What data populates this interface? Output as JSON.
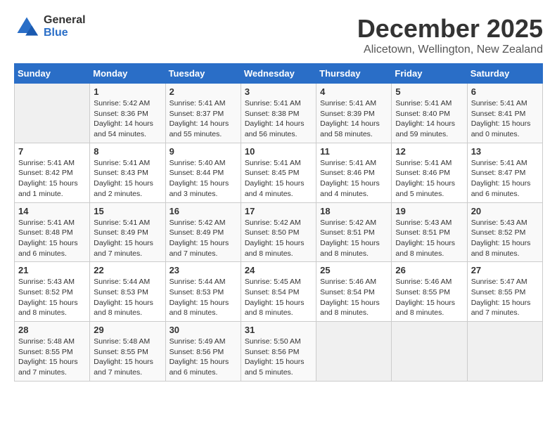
{
  "logo": {
    "general": "General",
    "blue": "Blue"
  },
  "title": "December 2025",
  "subtitle": "Alicetown, Wellington, New Zealand",
  "days_of_week": [
    "Sunday",
    "Monday",
    "Tuesday",
    "Wednesday",
    "Thursday",
    "Friday",
    "Saturday"
  ],
  "weeks": [
    [
      {
        "day": "",
        "info": ""
      },
      {
        "day": "1",
        "info": "Sunrise: 5:42 AM\nSunset: 8:36 PM\nDaylight: 14 hours\nand 54 minutes."
      },
      {
        "day": "2",
        "info": "Sunrise: 5:41 AM\nSunset: 8:37 PM\nDaylight: 14 hours\nand 55 minutes."
      },
      {
        "day": "3",
        "info": "Sunrise: 5:41 AM\nSunset: 8:38 PM\nDaylight: 14 hours\nand 56 minutes."
      },
      {
        "day": "4",
        "info": "Sunrise: 5:41 AM\nSunset: 8:39 PM\nDaylight: 14 hours\nand 58 minutes."
      },
      {
        "day": "5",
        "info": "Sunrise: 5:41 AM\nSunset: 8:40 PM\nDaylight: 14 hours\nand 59 minutes."
      },
      {
        "day": "6",
        "info": "Sunrise: 5:41 AM\nSunset: 8:41 PM\nDaylight: 15 hours\nand 0 minutes."
      }
    ],
    [
      {
        "day": "7",
        "info": "Sunrise: 5:41 AM\nSunset: 8:42 PM\nDaylight: 15 hours\nand 1 minute."
      },
      {
        "day": "8",
        "info": "Sunrise: 5:41 AM\nSunset: 8:43 PM\nDaylight: 15 hours\nand 2 minutes."
      },
      {
        "day": "9",
        "info": "Sunrise: 5:40 AM\nSunset: 8:44 PM\nDaylight: 15 hours\nand 3 minutes."
      },
      {
        "day": "10",
        "info": "Sunrise: 5:41 AM\nSunset: 8:45 PM\nDaylight: 15 hours\nand 4 minutes."
      },
      {
        "day": "11",
        "info": "Sunrise: 5:41 AM\nSunset: 8:46 PM\nDaylight: 15 hours\nand 4 minutes."
      },
      {
        "day": "12",
        "info": "Sunrise: 5:41 AM\nSunset: 8:46 PM\nDaylight: 15 hours\nand 5 minutes."
      },
      {
        "day": "13",
        "info": "Sunrise: 5:41 AM\nSunset: 8:47 PM\nDaylight: 15 hours\nand 6 minutes."
      }
    ],
    [
      {
        "day": "14",
        "info": "Sunrise: 5:41 AM\nSunset: 8:48 PM\nDaylight: 15 hours\nand 6 minutes."
      },
      {
        "day": "15",
        "info": "Sunrise: 5:41 AM\nSunset: 8:49 PM\nDaylight: 15 hours\nand 7 minutes."
      },
      {
        "day": "16",
        "info": "Sunrise: 5:42 AM\nSunset: 8:49 PM\nDaylight: 15 hours\nand 7 minutes."
      },
      {
        "day": "17",
        "info": "Sunrise: 5:42 AM\nSunset: 8:50 PM\nDaylight: 15 hours\nand 8 minutes."
      },
      {
        "day": "18",
        "info": "Sunrise: 5:42 AM\nSunset: 8:51 PM\nDaylight: 15 hours\nand 8 minutes."
      },
      {
        "day": "19",
        "info": "Sunrise: 5:43 AM\nSunset: 8:51 PM\nDaylight: 15 hours\nand 8 minutes."
      },
      {
        "day": "20",
        "info": "Sunrise: 5:43 AM\nSunset: 8:52 PM\nDaylight: 15 hours\nand 8 minutes."
      }
    ],
    [
      {
        "day": "21",
        "info": "Sunrise: 5:43 AM\nSunset: 8:52 PM\nDaylight: 15 hours\nand 8 minutes."
      },
      {
        "day": "22",
        "info": "Sunrise: 5:44 AM\nSunset: 8:53 PM\nDaylight: 15 hours\nand 8 minutes."
      },
      {
        "day": "23",
        "info": "Sunrise: 5:44 AM\nSunset: 8:53 PM\nDaylight: 15 hours\nand 8 minutes."
      },
      {
        "day": "24",
        "info": "Sunrise: 5:45 AM\nSunset: 8:54 PM\nDaylight: 15 hours\nand 8 minutes."
      },
      {
        "day": "25",
        "info": "Sunrise: 5:46 AM\nSunset: 8:54 PM\nDaylight: 15 hours\nand 8 minutes."
      },
      {
        "day": "26",
        "info": "Sunrise: 5:46 AM\nSunset: 8:55 PM\nDaylight: 15 hours\nand 8 minutes."
      },
      {
        "day": "27",
        "info": "Sunrise: 5:47 AM\nSunset: 8:55 PM\nDaylight: 15 hours\nand 7 minutes."
      }
    ],
    [
      {
        "day": "28",
        "info": "Sunrise: 5:48 AM\nSunset: 8:55 PM\nDaylight: 15 hours\nand 7 minutes."
      },
      {
        "day": "29",
        "info": "Sunrise: 5:48 AM\nSunset: 8:55 PM\nDaylight: 15 hours\nand 7 minutes."
      },
      {
        "day": "30",
        "info": "Sunrise: 5:49 AM\nSunset: 8:56 PM\nDaylight: 15 hours\nand 6 minutes."
      },
      {
        "day": "31",
        "info": "Sunrise: 5:50 AM\nSunset: 8:56 PM\nDaylight: 15 hours\nand 5 minutes."
      },
      {
        "day": "",
        "info": ""
      },
      {
        "day": "",
        "info": ""
      },
      {
        "day": "",
        "info": ""
      }
    ]
  ]
}
